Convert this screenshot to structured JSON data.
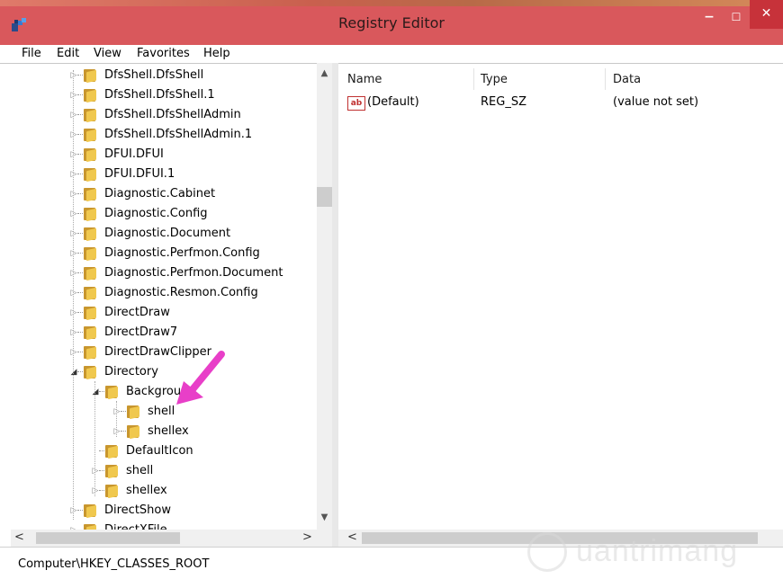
{
  "window": {
    "title": "Registry Editor"
  },
  "menu": [
    "File",
    "Edit",
    "View",
    "Favorites",
    "Help"
  ],
  "tree": {
    "rows": [
      {
        "label": "DfsShell.DfsShell",
        "level": 0,
        "state": "collapsed"
      },
      {
        "label": "DfsShell.DfsShell.1",
        "level": 0,
        "state": "collapsed"
      },
      {
        "label": "DfsShell.DfsShellAdmin",
        "level": 0,
        "state": "collapsed"
      },
      {
        "label": "DfsShell.DfsShellAdmin.1",
        "level": 0,
        "state": "collapsed"
      },
      {
        "label": "DFUI.DFUI",
        "level": 0,
        "state": "collapsed"
      },
      {
        "label": "DFUI.DFUI.1",
        "level": 0,
        "state": "collapsed"
      },
      {
        "label": "Diagnostic.Cabinet",
        "level": 0,
        "state": "collapsed"
      },
      {
        "label": "Diagnostic.Config",
        "level": 0,
        "state": "collapsed"
      },
      {
        "label": "Diagnostic.Document",
        "level": 0,
        "state": "collapsed"
      },
      {
        "label": "Diagnostic.Perfmon.Config",
        "level": 0,
        "state": "collapsed"
      },
      {
        "label": "Diagnostic.Perfmon.Document",
        "level": 0,
        "state": "collapsed"
      },
      {
        "label": "Diagnostic.Resmon.Config",
        "level": 0,
        "state": "collapsed"
      },
      {
        "label": "DirectDraw",
        "level": 0,
        "state": "collapsed"
      },
      {
        "label": "DirectDraw7",
        "level": 0,
        "state": "collapsed"
      },
      {
        "label": "DirectDrawClipper",
        "level": 0,
        "state": "collapsed"
      },
      {
        "label": "Directory",
        "level": 0,
        "state": "expanded"
      },
      {
        "label": "Backgrou",
        "level": 1,
        "state": "expanded"
      },
      {
        "label": "shell",
        "level": 2,
        "state": "collapsed"
      },
      {
        "label": "shellex",
        "level": 2,
        "state": "collapsed"
      },
      {
        "label": "DefaultIcon",
        "level": 1,
        "state": "leaf"
      },
      {
        "label": "shell",
        "level": 1,
        "state": "collapsed"
      },
      {
        "label": "shellex",
        "level": 1,
        "state": "collapsed"
      },
      {
        "label": "DirectShow",
        "level": 0,
        "state": "collapsed"
      },
      {
        "label": "DirectXFile",
        "level": 0,
        "state": "collapsed"
      }
    ]
  },
  "list": {
    "columns": [
      "Name",
      "Type",
      "Data"
    ],
    "rows": [
      {
        "name": "(Default)",
        "type": "REG_SZ",
        "data": "(value not set)"
      }
    ]
  },
  "status": {
    "path": "Computer\\HKEY_CLASSES_ROOT"
  },
  "watermark": {
    "text": "uantrimang"
  },
  "colors": {
    "titlebar": "#d9585c",
    "close": "#c7323a",
    "folder": "#f0c84e",
    "arrow": "#e83fc8"
  }
}
